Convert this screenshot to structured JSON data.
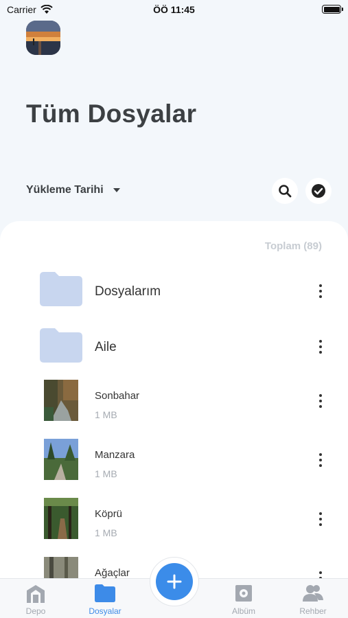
{
  "status_bar": {
    "carrier": "Carrier",
    "time": "ÖÖ 11:45"
  },
  "header": {
    "title": "Tüm Dosyalar",
    "sort_label": "Yükleme Tarihi"
  },
  "list": {
    "total_label": "Toplam (89)",
    "items": [
      {
        "name": "Dosyalarım",
        "type": "folder"
      },
      {
        "name": "Aile",
        "type": "folder"
      },
      {
        "name": "Sonbahar",
        "size": "1 MB",
        "type": "image"
      },
      {
        "name": "Manzara",
        "size": "1 MB",
        "type": "image"
      },
      {
        "name": "Köprü",
        "size": "1 MB",
        "type": "image"
      },
      {
        "name": "Ağaçlar",
        "type": "image"
      }
    ]
  },
  "tabbar": {
    "tabs": [
      {
        "label": "Depo",
        "icon": "storage-icon"
      },
      {
        "label": "Dosyalar",
        "icon": "folder-icon",
        "active": true
      },
      {
        "label": "Albüm",
        "icon": "album-icon"
      },
      {
        "label": "Rehber",
        "icon": "contacts-icon"
      }
    ],
    "fab_icon": "plus-icon"
  },
  "colors": {
    "accent": "#3b8ce9",
    "folder": "#c8d6ef",
    "background": "#f3f7fb"
  }
}
